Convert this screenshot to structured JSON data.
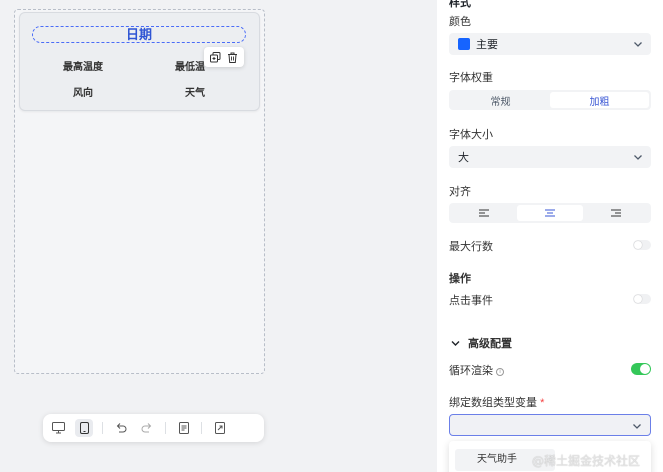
{
  "canvas": {
    "card": {
      "title": "日期",
      "cells": [
        "最高温度",
        "最低温",
        "风向",
        "天气"
      ]
    },
    "ops": [
      {
        "icon": "copy-icon"
      },
      {
        "icon": "trash-icon"
      }
    ]
  },
  "toolbar": {
    "buttons": [
      "desktop-icon",
      "mobile-icon",
      "undo-icon",
      "redo-icon",
      "document-icon",
      "export-icon"
    ]
  },
  "panel": {
    "section_style": "样式",
    "color": {
      "label": "颜色",
      "value": "主要",
      "swatch": "#1664ff"
    },
    "font_weight": {
      "label": "字体权重",
      "options": [
        "常规",
        "加粗"
      ],
      "selected": "加粗"
    },
    "font_size": {
      "label": "字体大小",
      "value": "大"
    },
    "align": {
      "label": "对齐",
      "options": [
        "left-align-icon",
        "center-align-icon",
        "right-align-icon"
      ],
      "selected": "center-align-icon"
    },
    "max_lines": {
      "label": "最大行数",
      "enabled": false
    },
    "section_ops": "操作",
    "click_event": {
      "label": "点击事件",
      "enabled": false
    },
    "advanced": {
      "label": "高级配置"
    },
    "loop_render": {
      "label": "循环渲染",
      "enabled": true
    },
    "bind_array": {
      "label": "绑定数组类型变量",
      "required": "*",
      "value": ""
    },
    "dropdown_option": "天气助手"
  },
  "watermark": "@稀土掘金技术社区",
  "colors": {
    "accent": "#3a57d4",
    "toggle_on": "#34c759",
    "required": "#f53f3f"
  }
}
